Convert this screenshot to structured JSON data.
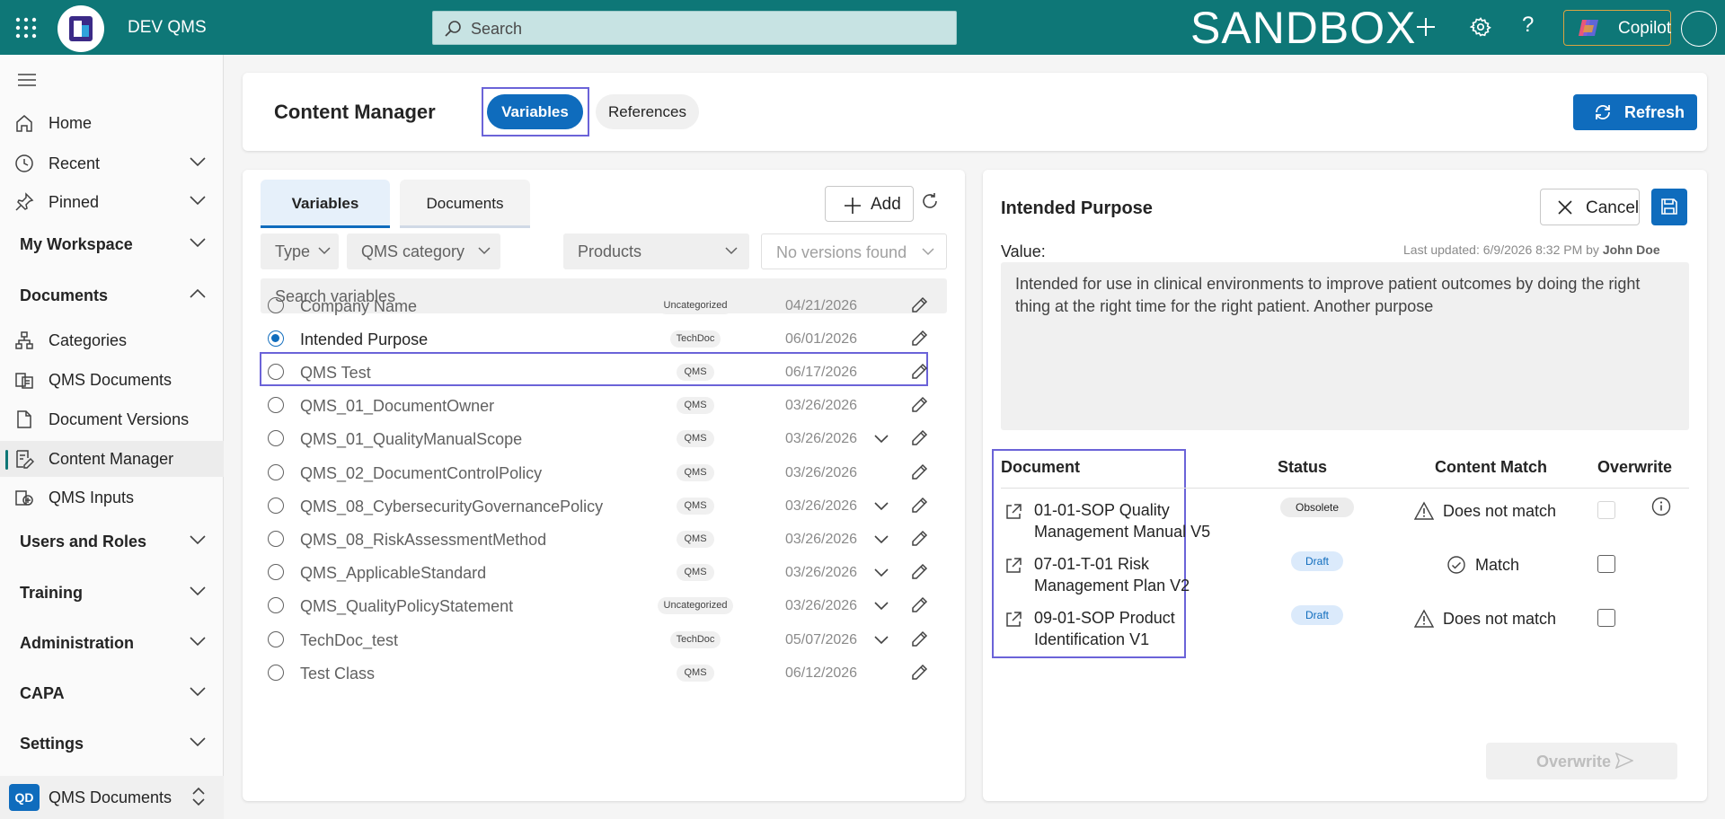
{
  "topbar": {
    "app_name": "DEV QMS",
    "search_placeholder": "Search",
    "environment": "SANDBOX",
    "copilot_label": "Copilot",
    "help_label": "?"
  },
  "sidebar": {
    "items": [
      {
        "label": "Home",
        "icon": "home-icon"
      },
      {
        "label": "Recent",
        "icon": "clock-icon"
      },
      {
        "label": "Pinned",
        "icon": "pin-icon"
      },
      {
        "label": "My Workspace",
        "section": true
      },
      {
        "label": "Documents",
        "section": true,
        "expanded": true
      },
      {
        "label": "Categories",
        "icon": "hierarchy-icon"
      },
      {
        "label": "QMS Documents",
        "icon": "documents-icon"
      },
      {
        "label": "Document Versions",
        "icon": "document-icon"
      },
      {
        "label": "Content Manager",
        "icon": "content-edit-icon",
        "active": true
      },
      {
        "label": "QMS Inputs",
        "icon": "inputs-icon"
      },
      {
        "label": "Users and Roles",
        "section": true
      },
      {
        "label": "Training",
        "section": true
      },
      {
        "label": "Administration",
        "section": true
      },
      {
        "label": "CAPA",
        "section": true
      },
      {
        "label": "Settings",
        "section": true
      }
    ],
    "bottom": {
      "badge": "QD",
      "label": "QMS Documents"
    }
  },
  "header": {
    "title": "Content Manager",
    "tabs": [
      "Variables",
      "References"
    ],
    "active_tab": "Variables",
    "refresh_label": "Refresh"
  },
  "left": {
    "tabs": [
      "Variables",
      "Documents"
    ],
    "add_label": "Add",
    "filters": [
      "Type",
      "QMS category",
      "Products",
      "No versions found"
    ],
    "search_placeholder": "Search variables",
    "rows": [
      {
        "name": "Company Name",
        "badge": "Uncategorized",
        "date": "04/21/2026",
        "expand": false
      },
      {
        "name": "Intended Purpose",
        "badge": "TechDoc",
        "date": "06/01/2026",
        "expand": false,
        "selected": true
      },
      {
        "name": "QMS Test",
        "badge": "QMS",
        "date": "06/17/2026",
        "expand": false
      },
      {
        "name": "QMS_01_DocumentOwner",
        "badge": "QMS",
        "date": "03/26/2026",
        "expand": false
      },
      {
        "name": "QMS_01_QualityManualScope",
        "badge": "QMS",
        "date": "03/26/2026",
        "expand": true
      },
      {
        "name": "QMS_02_DocumentControlPolicy",
        "badge": "QMS",
        "date": "03/26/2026",
        "expand": false
      },
      {
        "name": "QMS_08_CybersecurityGovernancePolicy",
        "badge": "QMS",
        "date": "03/26/2026",
        "expand": true
      },
      {
        "name": "QMS_08_RiskAssessmentMethod",
        "badge": "QMS",
        "date": "03/26/2026",
        "expand": true
      },
      {
        "name": "QMS_ApplicableStandard",
        "badge": "QMS",
        "date": "03/26/2026",
        "expand": true
      },
      {
        "name": "QMS_QualityPolicyStatement",
        "badge": "Uncategorized",
        "date": "03/26/2026",
        "expand": true
      },
      {
        "name": "TechDoc_test",
        "badge": "TechDoc",
        "date": "05/07/2026",
        "expand": true
      },
      {
        "name": "Test Class",
        "badge": "QMS",
        "date": "06/12/2026",
        "expand": false
      }
    ]
  },
  "right": {
    "title": "Intended Purpose",
    "cancel_label": "Cancel",
    "value_label": "Value:",
    "last_updated_prefix": "Last updated: 6/9/2026 8:32 PM by ",
    "last_updated_user": "John Doe",
    "value": "Intended for use in clinical environments to improve patient outcomes by doing the right thing at the right time for the right patient. Another purpose",
    "columns": [
      "Document",
      "Status",
      "Content Match",
      "Overwrite"
    ],
    "documents": [
      {
        "name_line1": "01-01-SOP Quality",
        "name_line2": "Management Manual V5",
        "status": "Obsolete",
        "match": "Does not match",
        "overwrite_enabled": false
      },
      {
        "name_line1": "07-01-T-01 Risk",
        "name_line2": "Management Plan V2",
        "status": "Draft",
        "match": "Match",
        "overwrite_enabled": true
      },
      {
        "name_line1": "09-01-SOP Product",
        "name_line2": "Identification V1",
        "status": "Draft",
        "match": "Does not match",
        "overwrite_enabled": true
      }
    ],
    "overwrite_label": "Overwrite"
  },
  "colors": {
    "topbar": "#0e7777",
    "primary": "#0f6cbd",
    "highlight_outline": "#6b63d8"
  }
}
